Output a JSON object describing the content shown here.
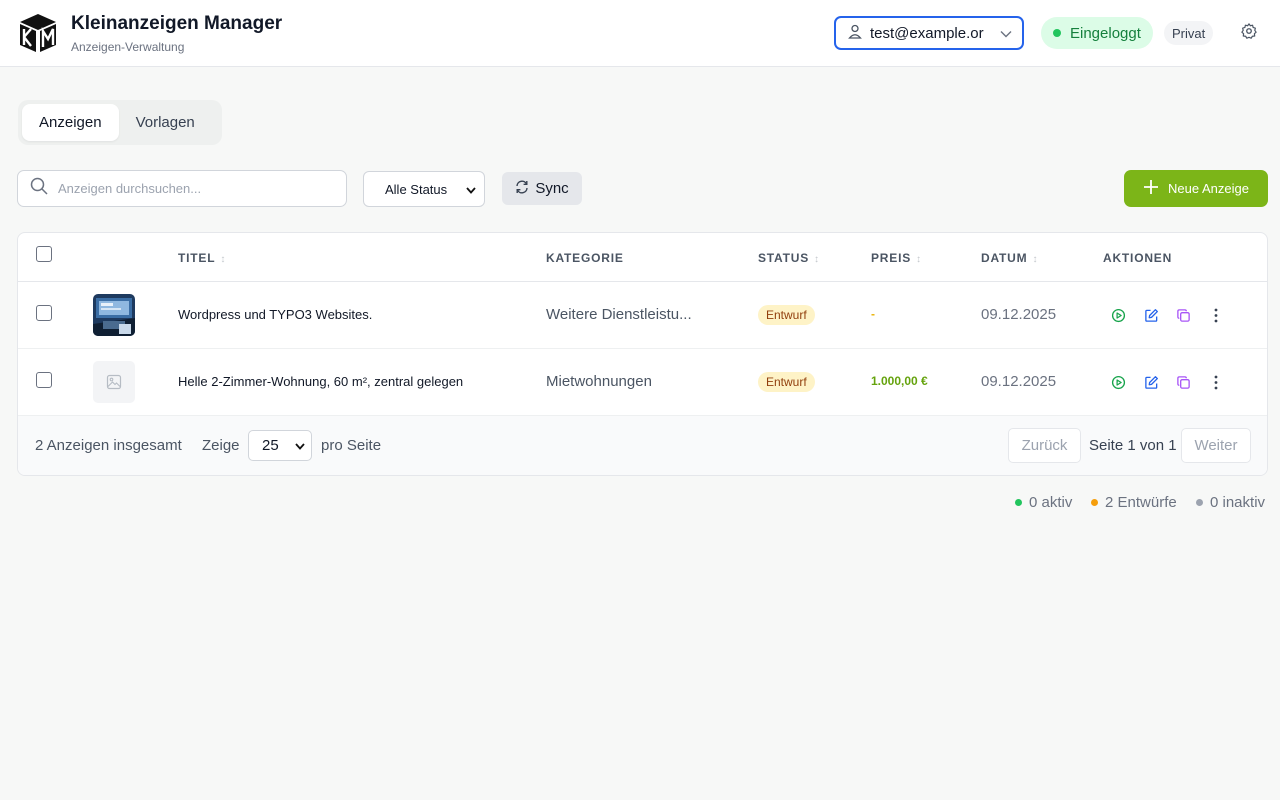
{
  "header": {
    "title": "Kleinanzeigen Manager",
    "subtitle": "Anzeigen-Verwaltung",
    "account": "test@example.or",
    "login_status": "Eingeloggt",
    "account_type": "Privat"
  },
  "tabs": [
    {
      "label": "Anzeigen",
      "active": true
    },
    {
      "label": "Vorlagen",
      "active": false
    }
  ],
  "toolbar": {
    "search_placeholder": "Anzeigen durchsuchen...",
    "status_filter": "Alle Status",
    "sync_label": "Sync",
    "new_label": "Neue Anzeige"
  },
  "table": {
    "columns": {
      "title": "TITEL",
      "category": "KATEGORIE",
      "status": "STATUS",
      "price": "PREIS",
      "date": "DATUM",
      "actions": "AKTIONEN"
    },
    "rows": [
      {
        "title": "Wordpress und TYPO3 Websites.",
        "category": "Weitere Dienstleistu...",
        "status": "Entwurf",
        "price": "-",
        "date": "09.12.2025",
        "has_image": true
      },
      {
        "title": "Helle 2-Zimmer-Wohnung, 60 m², zentral gelegen",
        "category": "Mietwohnungen",
        "status": "Entwurf",
        "price": "1.000,00 €",
        "date": "09.12.2025",
        "has_image": false
      }
    ]
  },
  "footer": {
    "total": "2 Anzeigen insgesamt",
    "show_label": "Zeige",
    "per_page": "25",
    "per_page_label": "pro Seite",
    "prev_label": "Zurück",
    "page_info": "Seite 1 von 1",
    "next_label": "Weiter"
  },
  "summary": {
    "active": "0 aktiv",
    "drafts": "2 Entwürfe",
    "inactive": "0 inaktiv"
  },
  "colors": {
    "accent": "#7cb518",
    "focus": "#2563eb",
    "active_dot": "#22c55e",
    "draft_dot": "#f59e0b",
    "inactive_dot": "#9ca3af"
  }
}
